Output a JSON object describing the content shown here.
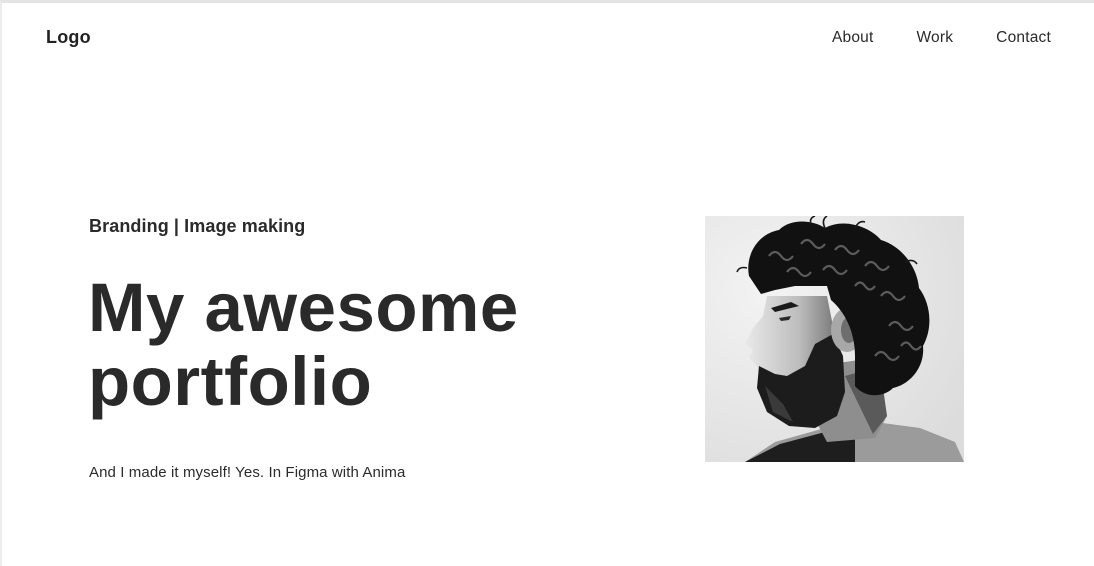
{
  "header": {
    "logo": "Logo",
    "nav": {
      "about": "About",
      "work": "Work",
      "contact": "Contact"
    }
  },
  "hero": {
    "tagline": "Branding | Image making",
    "headline_line1": "My awesome",
    "headline_line2": "portfolio",
    "subtext": "And I made it myself! Yes. In Figma with Anima"
  },
  "portrait": {
    "alt": "black and white profile portrait of a bearded man with curly hair"
  }
}
